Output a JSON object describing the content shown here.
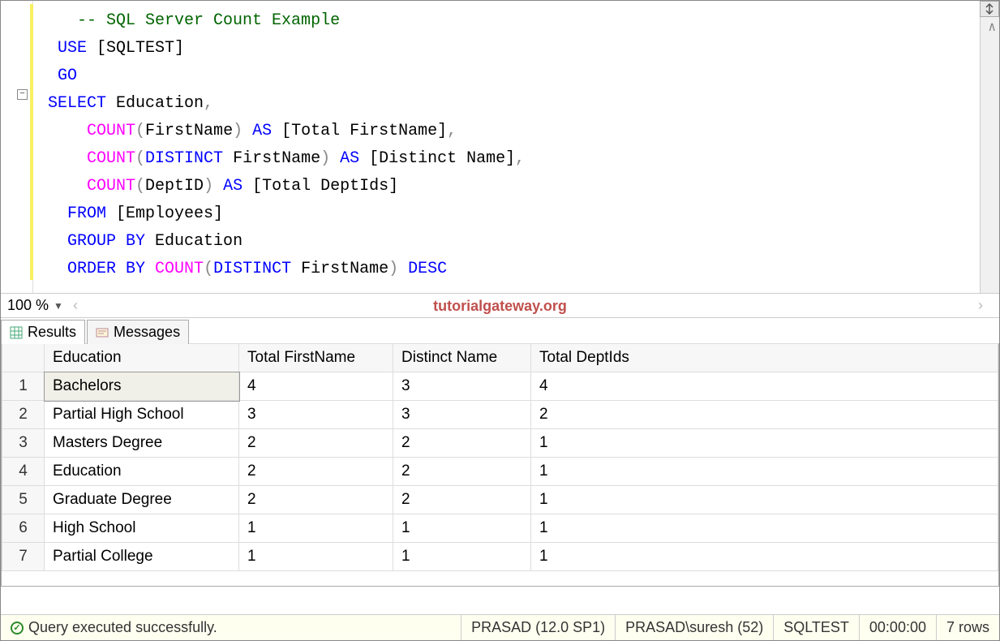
{
  "editor": {
    "lines": [
      {
        "indent": "   ",
        "tokens": [
          {
            "t": "-- SQL Server Count Example",
            "c": "cm"
          }
        ]
      },
      {
        "indent": " ",
        "tokens": [
          {
            "t": "USE ",
            "c": "kw"
          },
          {
            "t": "[SQLTEST]",
            "c": "tk"
          }
        ]
      },
      {
        "indent": " ",
        "tokens": [
          {
            "t": "GO",
            "c": "kw"
          }
        ]
      },
      {
        "indent": "",
        "tokens": [
          {
            "t": "SELECT ",
            "c": "kw"
          },
          {
            "t": "Education",
            "c": "tk"
          },
          {
            "t": ",",
            "c": "op"
          }
        ]
      },
      {
        "indent": "    ",
        "tokens": [
          {
            "t": "COUNT",
            "c": "fn"
          },
          {
            "t": "(",
            "c": "op"
          },
          {
            "t": "FirstName",
            "c": "tk"
          },
          {
            "t": ")",
            "c": "op"
          },
          {
            "t": " AS ",
            "c": "kw"
          },
          {
            "t": "[Total FirstName]",
            "c": "tk"
          },
          {
            "t": ",",
            "c": "op"
          }
        ]
      },
      {
        "indent": "    ",
        "tokens": [
          {
            "t": "COUNT",
            "c": "fn"
          },
          {
            "t": "(",
            "c": "op"
          },
          {
            "t": "DISTINCT ",
            "c": "kw"
          },
          {
            "t": "FirstName",
            "c": "tk"
          },
          {
            "t": ")",
            "c": "op"
          },
          {
            "t": " AS ",
            "c": "kw"
          },
          {
            "t": "[Distinct Name]",
            "c": "tk"
          },
          {
            "t": ",",
            "c": "op"
          }
        ]
      },
      {
        "indent": "    ",
        "tokens": [
          {
            "t": "COUNT",
            "c": "fn"
          },
          {
            "t": "(",
            "c": "op"
          },
          {
            "t": "DeptID",
            "c": "tk"
          },
          {
            "t": ")",
            "c": "op"
          },
          {
            "t": " AS ",
            "c": "kw"
          },
          {
            "t": "[Total DeptIds]",
            "c": "tk"
          }
        ]
      },
      {
        "indent": "  ",
        "tokens": [
          {
            "t": "FROM ",
            "c": "kw"
          },
          {
            "t": "[Employees]",
            "c": "tk"
          }
        ]
      },
      {
        "indent": "  ",
        "tokens": [
          {
            "t": "GROUP BY ",
            "c": "kw"
          },
          {
            "t": "Education",
            "c": "tk"
          }
        ]
      },
      {
        "indent": "  ",
        "tokens": [
          {
            "t": "ORDER BY ",
            "c": "kw"
          },
          {
            "t": "COUNT",
            "c": "fn"
          },
          {
            "t": "(",
            "c": "op"
          },
          {
            "t": "DISTINCT ",
            "c": "kw"
          },
          {
            "t": "FirstName",
            "c": "tk"
          },
          {
            "t": ")",
            "c": "op"
          },
          {
            "t": " DESC",
            "c": "kw"
          }
        ]
      }
    ]
  },
  "zoom": {
    "value": "100 %"
  },
  "watermark": "tutorialgateway.org",
  "tabs": {
    "results": "Results",
    "messages": "Messages"
  },
  "grid": {
    "headers": [
      "",
      "Education",
      "Total FirstName",
      "Distinct Name",
      "Total DeptIds"
    ],
    "rows": [
      {
        "n": "1",
        "edu": "Bachelors",
        "tf": "4",
        "dn": "3",
        "td": "4"
      },
      {
        "n": "2",
        "edu": "Partial High School",
        "tf": "3",
        "dn": "3",
        "td": "2"
      },
      {
        "n": "3",
        "edu": "Masters Degree",
        "tf": "2",
        "dn": "2",
        "td": "1"
      },
      {
        "n": "4",
        "edu": "Education",
        "tf": "2",
        "dn": "2",
        "td": "1"
      },
      {
        "n": "5",
        "edu": "Graduate Degree",
        "tf": "2",
        "dn": "2",
        "td": "1"
      },
      {
        "n": "6",
        "edu": "High School",
        "tf": "1",
        "dn": "1",
        "td": "1"
      },
      {
        "n": "7",
        "edu": "Partial College",
        "tf": "1",
        "dn": "1",
        "td": "1"
      }
    ]
  },
  "status": {
    "msg": "Query executed successfully.",
    "server": "PRASAD (12.0 SP1)",
    "user": "PRASAD\\suresh (52)",
    "db": "SQLTEST",
    "time": "00:00:00",
    "rows": "7 rows"
  }
}
